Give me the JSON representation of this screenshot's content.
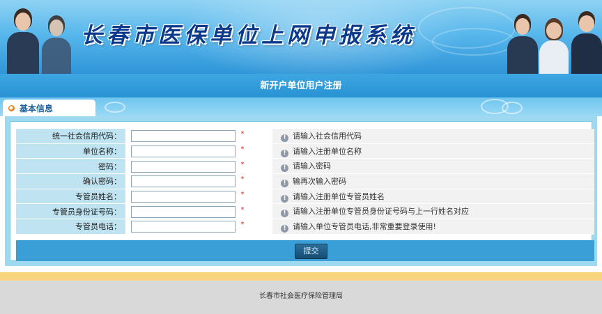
{
  "banner": {
    "title": "长春市医保单位上网申报系统"
  },
  "page_title": "新开户单位用户注册",
  "tab": {
    "label": "基本信息",
    "icon": "bullet-icon"
  },
  "form": {
    "required_mark": "*",
    "fields": [
      {
        "label": "统一社会信用代码：",
        "value": "",
        "hint": "请输入社会信用代码"
      },
      {
        "label": "单位名称：",
        "value": "",
        "hint": "请输入注册单位名称"
      },
      {
        "label": "密码：",
        "value": "",
        "hint": "请输入密码"
      },
      {
        "label": "确认密码：",
        "value": "",
        "hint": "输再次输入密码"
      },
      {
        "label": "专管员姓名：",
        "value": "",
        "hint": "请输入注册单位专管员姓名"
      },
      {
        "label": "专管员身份证号码：",
        "value": "",
        "hint": "请输入注册单位专管员身份证号码与上一行姓名对应"
      },
      {
        "label": "专管员电话：",
        "value": "",
        "hint": "请输入单位专管员电话,非常重要登录使用!"
      }
    ],
    "submit_label": "提交"
  },
  "footer": {
    "text": "长春市社会医疗保险管理局"
  },
  "colors": {
    "banner_blue": "#2f95d8",
    "label_bg": "#bfe3f1",
    "hint_bg": "#f2f2f2",
    "submit_row": "#3a9fd6",
    "gold_bar": "#f8d47e",
    "footer_bg": "#d9d9d9"
  }
}
